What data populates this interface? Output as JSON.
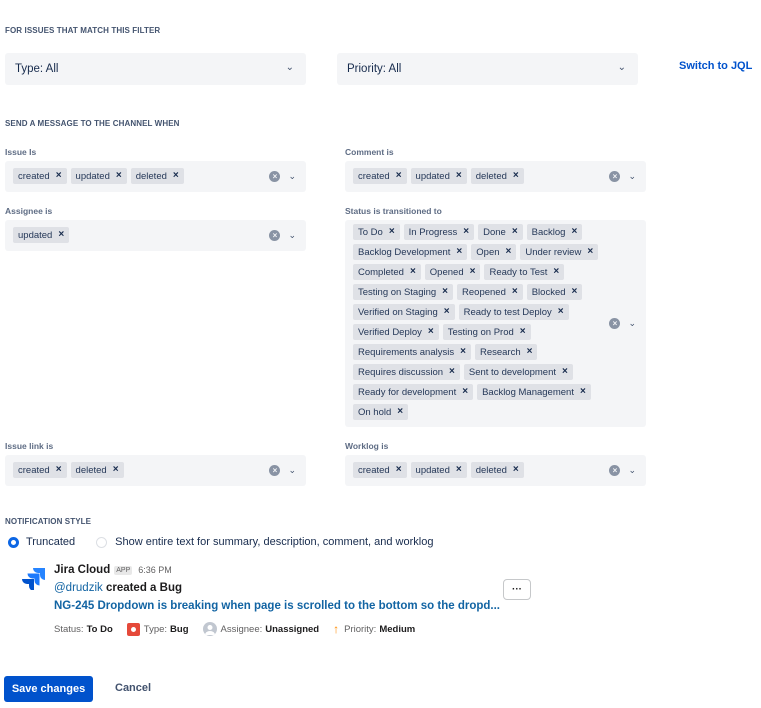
{
  "filter": {
    "section_title": "FOR ISSUES THAT MATCH THIS FILTER",
    "type_select": "Type: All",
    "priority_select": "Priority: All",
    "switch_link": "Switch to JQL"
  },
  "send": {
    "section_title": "SEND A MESSAGE TO THE CHANNEL WHEN",
    "issue_is": {
      "label": "Issue Is",
      "tags": [
        "created",
        "updated",
        "deleted"
      ]
    },
    "comment_is": {
      "label": "Comment is",
      "tags": [
        "created",
        "updated",
        "deleted"
      ]
    },
    "assignee_is": {
      "label": "Assignee is",
      "tags": [
        "updated"
      ]
    },
    "status_transitioned": {
      "label": "Status is transitioned to",
      "tags": [
        "To Do",
        "In Progress",
        "Done",
        "Backlog",
        "Backlog Development",
        "Open",
        "Under review",
        "Completed",
        "Opened",
        "Ready to Test",
        "Testing on Staging",
        "Reopened",
        "Blocked",
        "Verified on Staging",
        "Ready to test Deploy",
        "Verified Deploy",
        "Testing on Prod",
        "Requirements analysis",
        "Research",
        "Requires discussion",
        "Sent to development",
        "Ready for development",
        "Backlog Management",
        "On hold"
      ]
    },
    "issue_link_is": {
      "label": "Issue link is",
      "tags": [
        "created",
        "deleted"
      ]
    },
    "worklog_is": {
      "label": "Worklog is",
      "tags": [
        "created",
        "updated",
        "deleted"
      ]
    },
    "tag_remove_glyph": "×",
    "clear_glyph": "×",
    "dropdown_glyph": "⌄"
  },
  "notification": {
    "section_title": "NOTIFICATION STYLE",
    "option_truncated": "Truncated",
    "option_full": "Show entire text for summary, description, comment, and worklog",
    "selected": "Truncated"
  },
  "preview": {
    "app_name": "Jira Cloud",
    "app_badge": "APP",
    "time": "6:36 PM",
    "user": "@drudzik",
    "action": " created a Bug",
    "issue_link": "NG-245 Dropdown is breaking when page is scrolled to the bottom so the dropd...",
    "status_label": "Status:",
    "status_value": "To Do",
    "type_label": "Type:",
    "type_value": "Bug",
    "assignee_label": "Assignee:",
    "assignee_value": "Unassigned",
    "priority_label": "Priority:",
    "priority_value": "Medium",
    "more_glyph": "···"
  },
  "actions": {
    "save": "Save changes",
    "cancel": "Cancel"
  },
  "colors": {
    "primary": "#0052cc",
    "field_bg": "#f4f5f7",
    "tag_bg": "#dfe1e6",
    "bug": "#e5493a",
    "priority_medium": "#ff8b00"
  },
  "icons": [
    "chevron-down-icon",
    "clear-icon",
    "remove-tag-icon",
    "jira-logo-icon",
    "bug-icon",
    "user-avatar-icon",
    "arrow-up-icon",
    "more-icon"
  ]
}
